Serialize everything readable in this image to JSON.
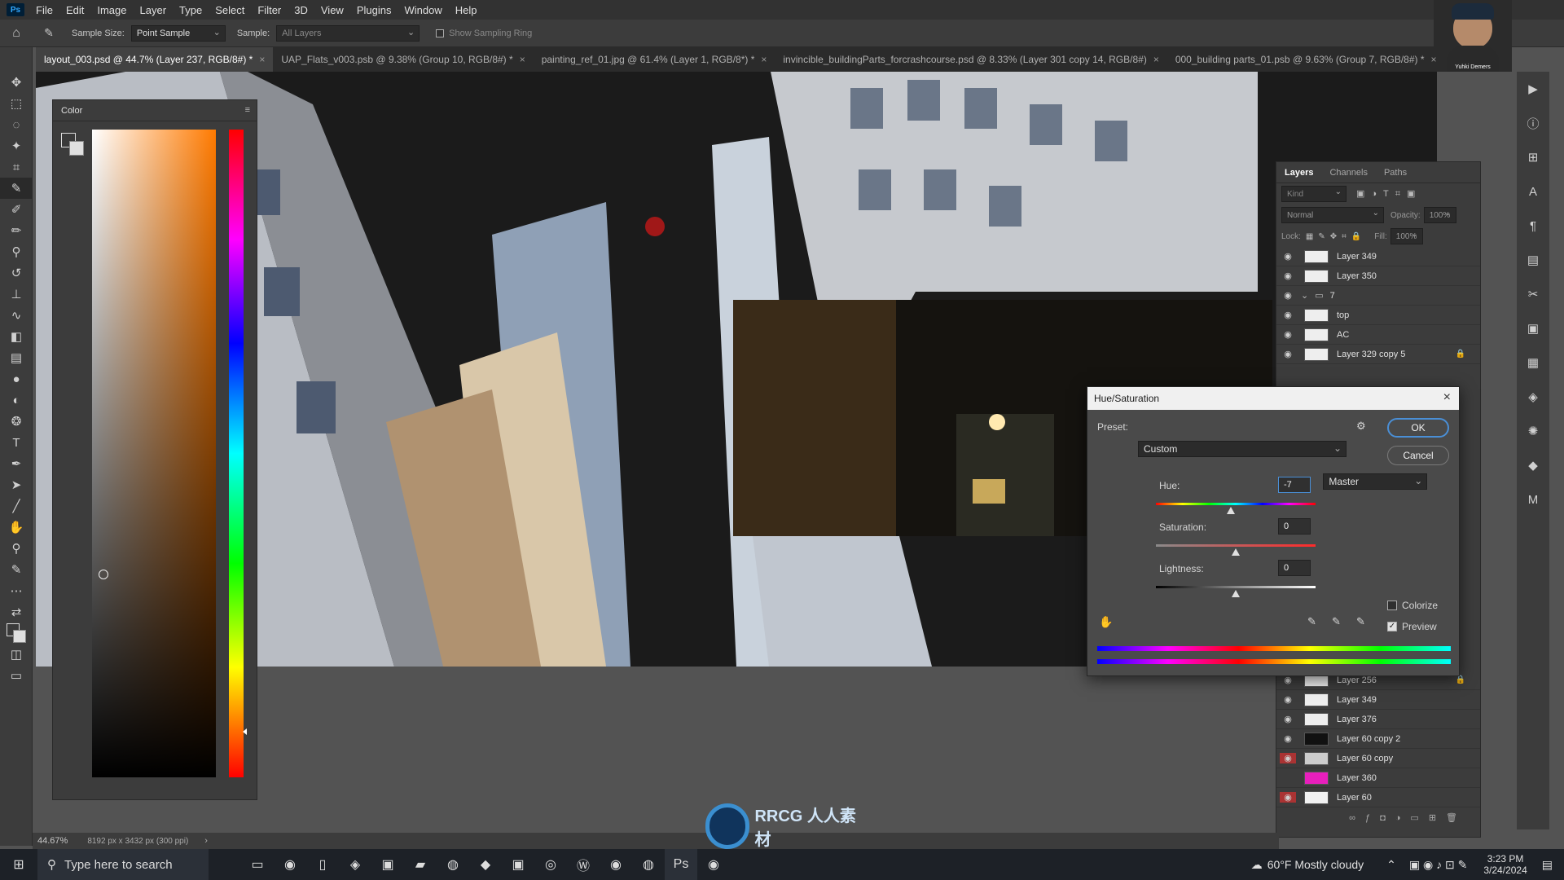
{
  "menu": [
    "File",
    "Edit",
    "Image",
    "Layer",
    "Type",
    "Select",
    "Filter",
    "3D",
    "View",
    "Plugins",
    "Window",
    "Help"
  ],
  "app_logo": "Ps",
  "options": {
    "sample_size_label": "Sample Size:",
    "sample_size_value": "Point Sample",
    "sample_label": "Sample:",
    "sample_value": "All Layers",
    "sampling_ring_label": "Show Sampling Ring"
  },
  "tabs": [
    "layout_003.psd @ 44.7% (Layer 237, RGB/8#) *",
    "UAP_Flats_v003.psb @ 9.38% (Group 10, RGB/8#) *",
    "painting_ref_01.jpg @ 61.4% (Layer 1, RGB/8*) *",
    "invincible_buildingParts_forcrashcourse.psd @ 8.33% (Layer 301 copy 14, RGB/8#)",
    "000_building parts_01.psb @ 9.63% (Group 7, RGB/8#) *"
  ],
  "color_panel": {
    "title": "Color"
  },
  "layers_panel": {
    "tabs": [
      "Layers",
      "Channels",
      "Paths"
    ],
    "kind_placeholder": "Kind",
    "blend_mode": "Normal",
    "opacity_label": "Opacity:",
    "opacity_value": "100%",
    "lock_label": "Lock:",
    "fill_label": "Fill:",
    "fill_value": "100%",
    "layers_top": [
      "Layer 349",
      "Layer 350",
      "7",
      "top",
      "AC",
      "Layer 329 copy 5"
    ],
    "layers_bottom": [
      "Layer 256",
      "Layer 349",
      "Layer 376",
      "Layer 60 copy 2",
      "Layer 60 copy",
      "Layer 360",
      "Layer 60"
    ]
  },
  "dialog": {
    "title": "Hue/Saturation",
    "preset_label": "Preset:",
    "preset_value": "Custom",
    "channel_value": "Master",
    "hue_label": "Hue:",
    "hue_value": "-7",
    "saturation_label": "Saturation:",
    "saturation_value": "0",
    "lightness_label": "Lightness:",
    "lightness_value": "0",
    "ok_label": "OK",
    "cancel_label": "Cancel",
    "colorize_label": "Colorize",
    "preview_label": "Preview",
    "colorize_checked": false,
    "preview_checked": true
  },
  "status": {
    "zoom": "44.67%",
    "dimensions": "8192 px x 3432 px (300 ppi)"
  },
  "webcam_name": "Yuhki Demers",
  "taskbar": {
    "search_placeholder": "Type here to search",
    "weather": "60°F  Mostly cloudy",
    "time": "3:23 PM",
    "date": "3/24/2024"
  },
  "watermark": "RRCG 人人素材",
  "colors": {
    "accent": "#4a8fd6",
    "panel": "#3c3c3c",
    "bg": "#535353"
  }
}
